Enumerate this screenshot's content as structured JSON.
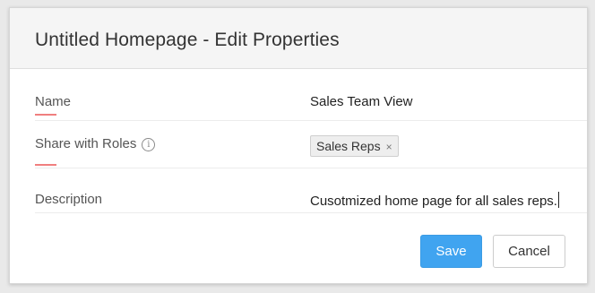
{
  "dialog": {
    "title": "Untitled Homepage - Edit Properties"
  },
  "fields": {
    "name": {
      "label": "Name",
      "value": "Sales Team View"
    },
    "roles": {
      "label": "Share with Roles",
      "info_icon": "info-icon",
      "tags": [
        {
          "label": "Sales Reps",
          "remove_glyph": "×"
        }
      ]
    },
    "description": {
      "label": "Description",
      "value": "Cusotmized home page for all sales reps."
    }
  },
  "actions": {
    "save_label": "Save",
    "cancel_label": "Cancel"
  },
  "colors": {
    "primary_button": "#40a4f0",
    "label_accent": "#f07f7f"
  }
}
